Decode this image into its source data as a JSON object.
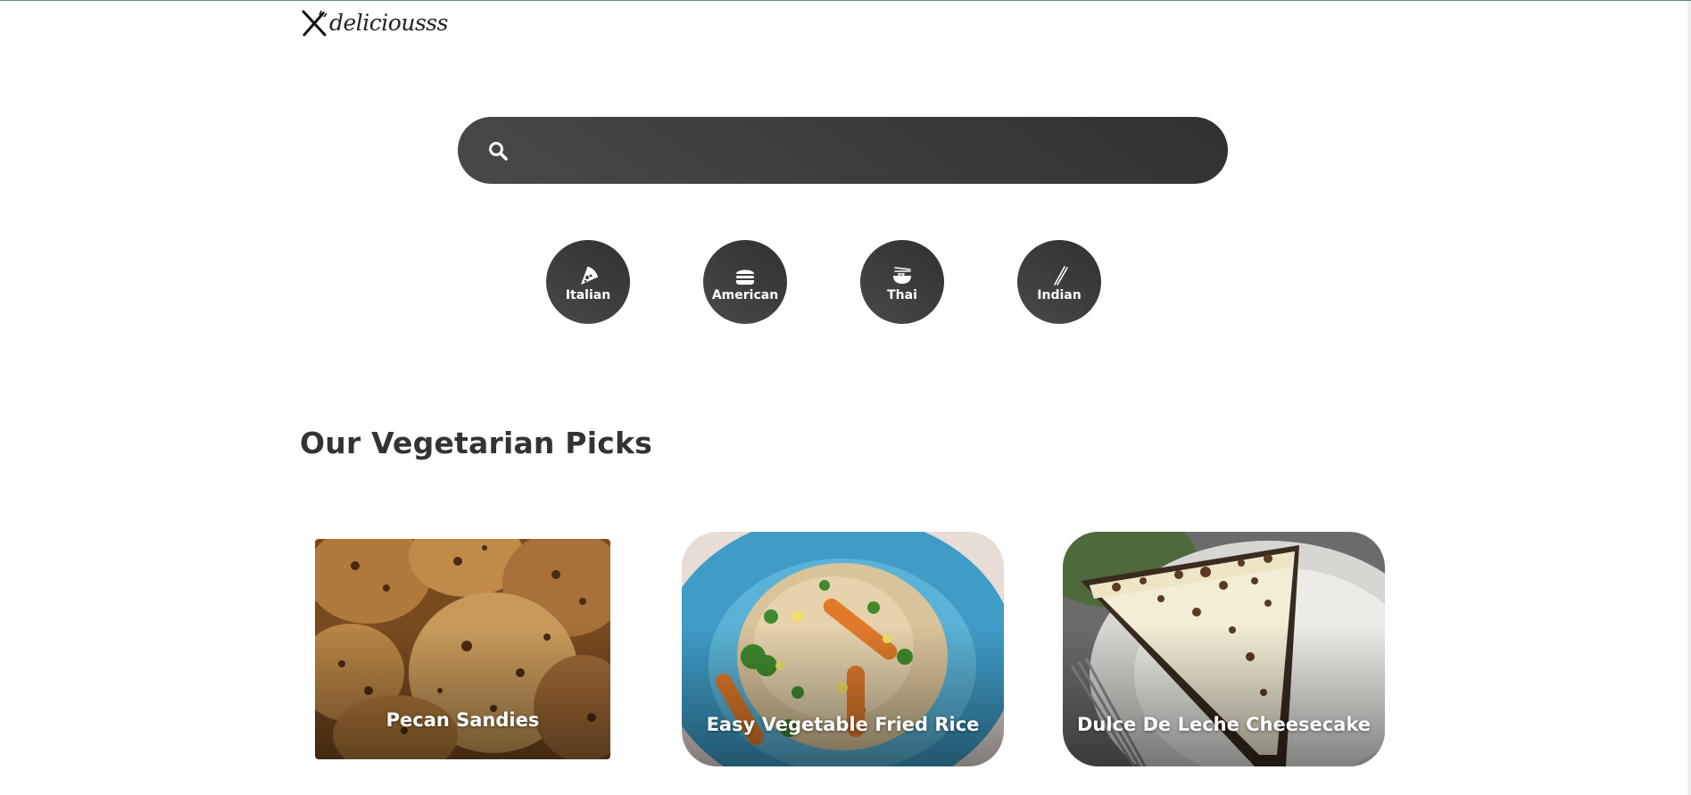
{
  "header": {
    "logo_text": "deliciousss",
    "logo_icon": "fork-knife-icon"
  },
  "search": {
    "icon": "search-icon",
    "value": "",
    "placeholder": ""
  },
  "categories": [
    {
      "label": "Italian",
      "icon": "pizza-icon"
    },
    {
      "label": "American",
      "icon": "hamburger-icon"
    },
    {
      "label": "Thai",
      "icon": "noodle-bowl-icon"
    },
    {
      "label": "Indian",
      "icon": "chopsticks-icon"
    }
  ],
  "section": {
    "title": "Our Vegetarian Picks"
  },
  "recipes": [
    {
      "title": "Pecan Sandies"
    },
    {
      "title": "Easy Vegetable Fried Rice"
    },
    {
      "title": "Dulce De Leche Cheesecake"
    }
  ],
  "colors": {
    "dark_button": "#3f3f3f",
    "heading_text": "#333333",
    "background": "#ffffff"
  }
}
